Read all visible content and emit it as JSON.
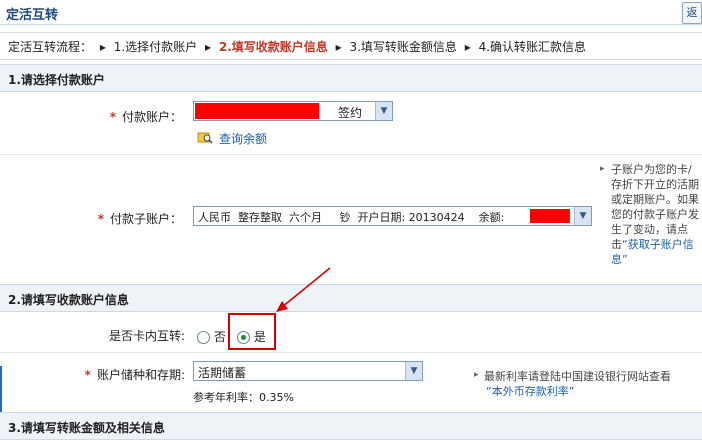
{
  "header": {
    "title": "定活互转",
    "back_label": "返"
  },
  "steps": {
    "prefix": "定活互转流程：",
    "items": [
      "1.选择付款账户",
      "2.填写收款账户信息",
      "3.填写转账金额信息",
      "4.确认转账汇款信息"
    ],
    "sep": "▸"
  },
  "section1": {
    "title": "1.请选择付款账户",
    "payer_label": "付款账户：",
    "payer_status": "签约",
    "query_balance": "查询余额",
    "sub_label": "付款子账户：",
    "sub_value": "人民币  整存整取  六个月     钞  开户日期: 20130424    余额:",
    "hint_text": "子账户为您的卡/存折下开立的活期或定期账户。如果您的付款子账户发生了变动，请点击",
    "hint_link": "“获取子账户信息”"
  },
  "section2": {
    "title": "2.请填写收款账户信息",
    "intra_label": "是否卡内互转:",
    "opt_no": "否",
    "opt_yes": "是",
    "deposit_label": "账户储种和存期:",
    "deposit_value": "活期储蓄",
    "rate": "参考年利率：0.35%",
    "rate_hint": "最新利率请登陆中国建设银行网站查看",
    "rate_link": "“本外币存款利率”"
  },
  "section3": {
    "title": "3.请填写转账金额及相关信息"
  },
  "colors": {
    "accent": "#c0392b",
    "link": "#1f5fa8",
    "header_bg": "#eef3f8"
  }
}
